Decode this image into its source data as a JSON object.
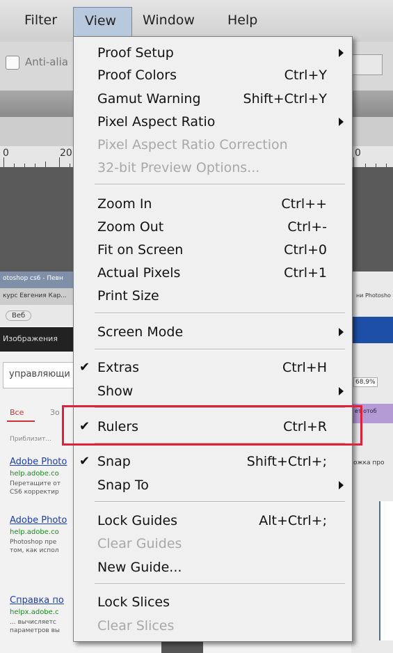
{
  "menubar": {
    "items": [
      {
        "label": "Filter"
      },
      {
        "label": "View"
      },
      {
        "label": "Window"
      },
      {
        "label": "Help"
      }
    ]
  },
  "options_bar": {
    "anti_alias_label": "Anti-alia"
  },
  "ruler": {
    "numbers": [
      "0",
      "20",
      "0"
    ]
  },
  "browser": {
    "tab1": "otoshop cs6 - Певн",
    "tab2": "курс Евгения Кар...",
    "nav": "Веб",
    "dark_label": "Изображения",
    "search_text": "управляющи",
    "filter_all": "Все",
    "filter_more": "Зо",
    "hint": "Приблизит...",
    "results": [
      {
        "title": "Adobe Photo",
        "url": "help.adobe.co",
        "snippet1": "Перетащите от",
        "snippet2": "CS6 корректир"
      },
      {
        "title": "Adobe Photo",
        "url": "help.adobe.co",
        "snippet1": "Photoshop пре",
        "snippet2": "том, как испол"
      },
      {
        "title": "Справка по",
        "url": "helpx.adobe.c",
        "snippet1": "... вычисляетс",
        "snippet2": "параметров вы"
      }
    ],
    "right_snippets": [
      "ни Photosho",
      "68,9%",
      "ет отоб",
      "ожка про"
    ]
  },
  "view_menu": {
    "items": [
      {
        "label": "Proof Setup",
        "shortcut": "",
        "submenu": true,
        "disabled": false,
        "checked": false
      },
      {
        "label": "Proof Colors",
        "shortcut": "Ctrl+Y",
        "submenu": false,
        "disabled": false,
        "checked": false
      },
      {
        "label": "Gamut Warning",
        "shortcut": "Shift+Ctrl+Y",
        "submenu": false,
        "disabled": false,
        "checked": false
      },
      {
        "label": "Pixel Aspect Ratio",
        "shortcut": "",
        "submenu": true,
        "disabled": false,
        "checked": false
      },
      {
        "label": "Pixel Aspect Ratio Correction",
        "shortcut": "",
        "submenu": false,
        "disabled": true,
        "checked": false
      },
      {
        "label": "32-bit Preview Options...",
        "shortcut": "",
        "submenu": false,
        "disabled": true,
        "checked": false
      },
      {
        "label": "Zoom In",
        "shortcut": "Ctrl++",
        "submenu": false,
        "disabled": false,
        "checked": false
      },
      {
        "label": "Zoom Out",
        "shortcut": "Ctrl+-",
        "submenu": false,
        "disabled": false,
        "checked": false
      },
      {
        "label": "Fit on Screen",
        "shortcut": "Ctrl+0",
        "submenu": false,
        "disabled": false,
        "checked": false
      },
      {
        "label": "Actual Pixels",
        "shortcut": "Ctrl+1",
        "submenu": false,
        "disabled": false,
        "checked": false
      },
      {
        "label": "Print Size",
        "shortcut": "",
        "submenu": false,
        "disabled": false,
        "checked": false
      },
      {
        "label": "Screen Mode",
        "shortcut": "",
        "submenu": true,
        "disabled": false,
        "checked": false
      },
      {
        "label": "Extras",
        "shortcut": "Ctrl+H",
        "submenu": false,
        "disabled": false,
        "checked": true
      },
      {
        "label": "Show",
        "shortcut": "",
        "submenu": true,
        "disabled": false,
        "checked": false
      },
      {
        "label": "Rulers",
        "shortcut": "Ctrl+R",
        "submenu": false,
        "disabled": false,
        "checked": true
      },
      {
        "label": "Snap",
        "shortcut": "Shift+Ctrl+;",
        "submenu": false,
        "disabled": false,
        "checked": true
      },
      {
        "label": "Snap To",
        "shortcut": "",
        "submenu": true,
        "disabled": false,
        "checked": false
      },
      {
        "label": "Lock Guides",
        "shortcut": "Alt+Ctrl+;",
        "submenu": false,
        "disabled": false,
        "checked": false
      },
      {
        "label": "Clear Guides",
        "shortcut": "",
        "submenu": false,
        "disabled": true,
        "checked": false
      },
      {
        "label": "New Guide...",
        "shortcut": "",
        "submenu": false,
        "disabled": false,
        "checked": false
      },
      {
        "label": "Lock Slices",
        "shortcut": "",
        "submenu": false,
        "disabled": false,
        "checked": false
      },
      {
        "label": "Clear Slices",
        "shortcut": "",
        "submenu": false,
        "disabled": true,
        "checked": false
      }
    ],
    "checkmark_glyph": "✔"
  },
  "colors": {
    "highlight": "#e0213b",
    "menu_bg": "#f0f0f0",
    "view_active": "#b9c9dd"
  }
}
